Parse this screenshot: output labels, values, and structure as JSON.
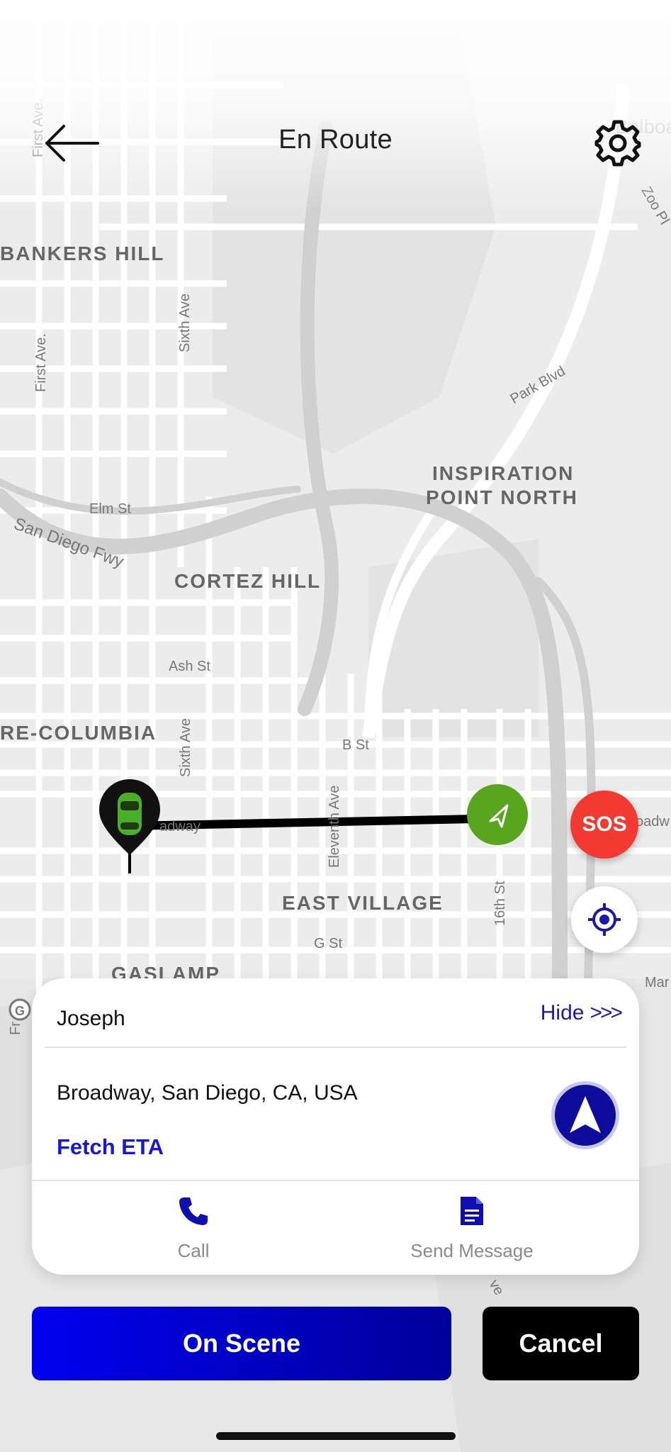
{
  "header": {
    "title": "En Route",
    "back_icon": "arrow-left-icon",
    "settings_icon": "gear-icon"
  },
  "map": {
    "labels": [
      "BANKERS HILL",
      "CORTEZ HILL",
      "INSPIRATION",
      "POINT NORTH",
      "RE-COLUMBIA",
      "EAST VILLAGE",
      "GASLAMP",
      "First Ave.",
      "First Ave.",
      "Sixth Ave",
      "Sixth Ave",
      "Elm St",
      "San Diego Fwy",
      "Ash St",
      "B St",
      "Eleventh Ave",
      "16th St",
      "G St",
      "Park Blvd",
      "Zoo Pl",
      "adway",
      "oadw",
      "Mar",
      "Balboa",
      "Fr St",
      "ve"
    ],
    "route_color": "#000000",
    "car_color": "#4caf2a",
    "destination_color": "#5aa51e"
  },
  "controls": {
    "sos_label": "SOS",
    "sos_color": "#f23a30",
    "locate_icon": "crosshair-icon"
  },
  "trip_card": {
    "rider_name": "Joseph",
    "hide_label": "Hide",
    "hide_chevrons": ">>>",
    "address": "Broadway, San Diego, CA, USA",
    "fetch_eta_label": "Fetch ETA",
    "navigate_icon": "navigation-arrow-icon",
    "actions": [
      {
        "label": "Call",
        "icon": "phone-icon"
      },
      {
        "label": "Send Message",
        "icon": "document-icon"
      }
    ]
  },
  "buttons": {
    "on_scene_label": "On Scene",
    "cancel_label": "Cancel"
  },
  "colors": {
    "primary_blue": "#0000f0",
    "link_blue": "#1717d6",
    "hide_blue": "#1c1ca8",
    "nav_blue": "#0e0c9c"
  }
}
